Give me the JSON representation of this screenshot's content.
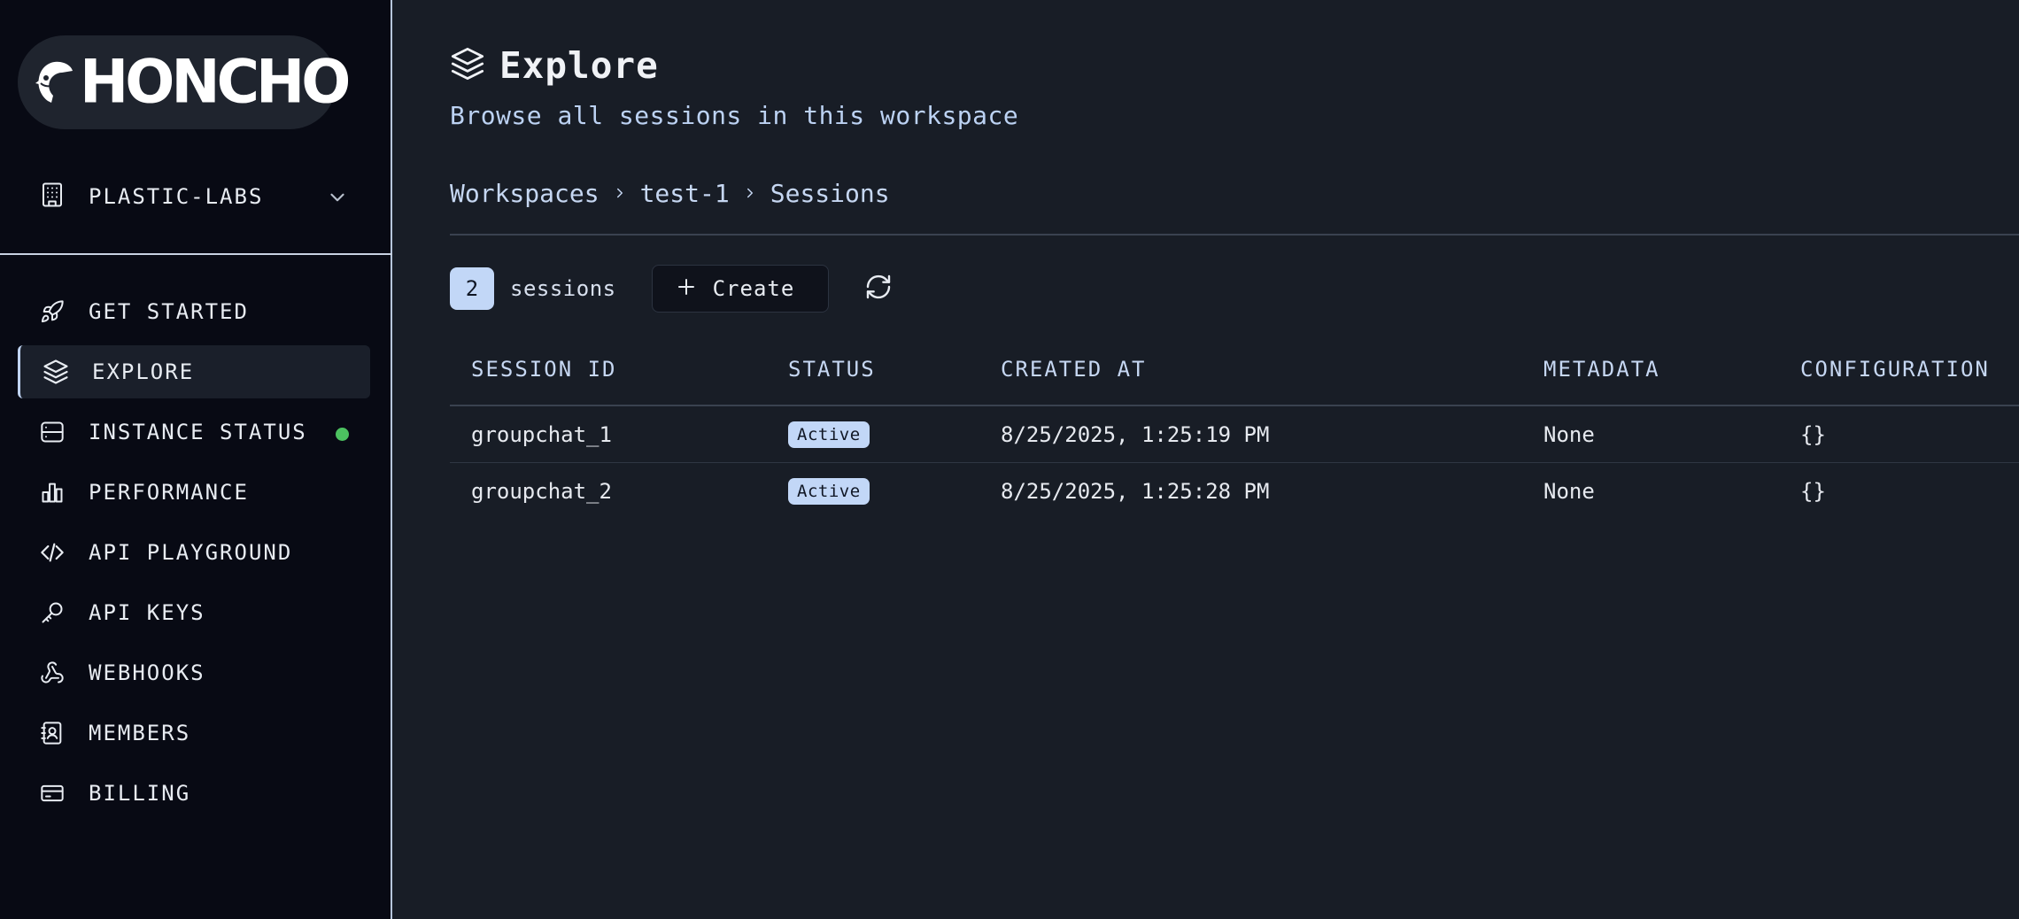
{
  "brand": {
    "logo_text": "HONCHO"
  },
  "workspace_selector": {
    "label": "PLASTIC-LABS"
  },
  "nav": {
    "items": [
      {
        "label": "GET STARTED",
        "icon": "rocket-icon"
      },
      {
        "label": "EXPLORE",
        "icon": "layers-icon",
        "active": true
      },
      {
        "label": "INSTANCE STATUS",
        "icon": "server-icon",
        "status": "online"
      },
      {
        "label": "PERFORMANCE",
        "icon": "bar-chart-icon"
      },
      {
        "label": "API PLAYGROUND",
        "icon": "code-icon"
      },
      {
        "label": "API KEYS",
        "icon": "key-icon"
      },
      {
        "label": "WEBHOOKS",
        "icon": "webhook-icon"
      },
      {
        "label": "MEMBERS",
        "icon": "contact-book-icon"
      },
      {
        "label": "BILLING",
        "icon": "credit-card-icon"
      }
    ]
  },
  "page": {
    "title": "Explore",
    "subtitle": "Browse all sessions in this workspace"
  },
  "breadcrumb": [
    "Workspaces",
    "test-1",
    "Sessions"
  ],
  "toolbar": {
    "count": "2",
    "count_label": "sessions",
    "create_label": "Create"
  },
  "table": {
    "columns": [
      "SESSION ID",
      "STATUS",
      "CREATED AT",
      "METADATA",
      "CONFIGURATION"
    ],
    "rows": [
      {
        "session_id": "groupchat_1",
        "status": "Active",
        "created_at": "8/25/2025, 1:25:19 PM",
        "metadata": "None",
        "configuration": "{}"
      },
      {
        "session_id": "groupchat_2",
        "status": "Active",
        "created_at": "8/25/2025, 1:25:28 PM",
        "metadata": "None",
        "configuration": "{}"
      }
    ]
  },
  "colors": {
    "accent": "#c2d7f7",
    "status_online": "#4cc160",
    "sidebar_bg": "#080a14",
    "main_bg": "#181d26"
  }
}
